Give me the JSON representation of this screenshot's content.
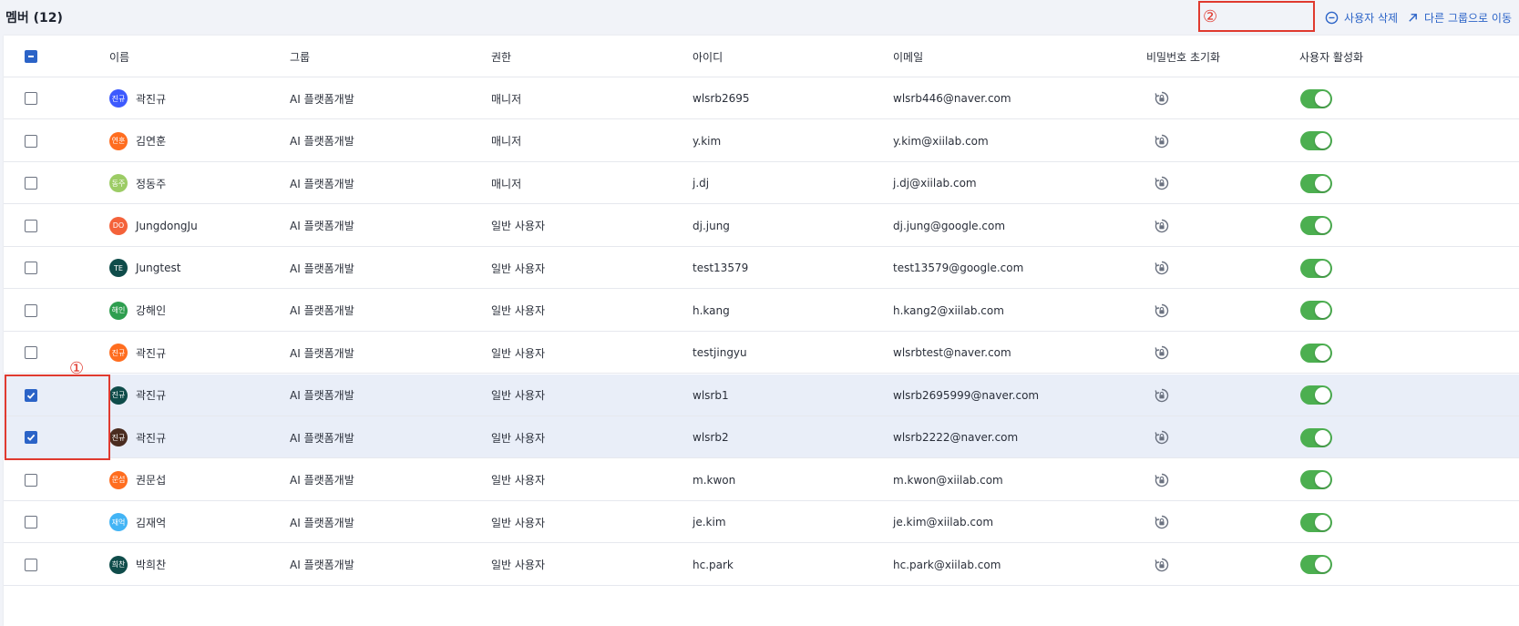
{
  "header": {
    "title": "멤버 (12)",
    "delete_label": "사용자 삭제",
    "move_label": "다른 그룹으로 이동"
  },
  "annotations": {
    "one": "①",
    "two": "②"
  },
  "columns": {
    "name": "이름",
    "group": "그룹",
    "role": "권한",
    "id": "아이디",
    "email": "이메일",
    "reset": "비밀번호 초기화",
    "active": "사용자 활성화"
  },
  "rows": [
    {
      "avatar": "진규",
      "avatar_color": "#3d5afe",
      "name": "곽진규",
      "group": "AI 플랫폼개발",
      "role": "매니저",
      "id": "wlsrb2695",
      "email": "wlsrb446@naver.com",
      "checked": false,
      "active": true
    },
    {
      "avatar": "연훈",
      "avatar_color": "#ff6d1f",
      "name": "김연훈",
      "group": "AI 플랫폼개발",
      "role": "매니저",
      "id": "y.kim",
      "email": "y.kim@xiilab.com",
      "checked": false,
      "active": true
    },
    {
      "avatar": "동주",
      "avatar_color": "#9ccc65",
      "name": "정동주",
      "group": "AI 플랫폼개발",
      "role": "매니저",
      "id": "j.dj",
      "email": "j.dj@xiilab.com",
      "checked": false,
      "active": true
    },
    {
      "avatar": "DO",
      "avatar_color": "#f4623a",
      "name": "JungdongJu",
      "group": "AI 플랫폼개발",
      "role": "일반 사용자",
      "id": "dj.jung",
      "email": "dj.jung@google.com",
      "checked": false,
      "active": true
    },
    {
      "avatar": "TE",
      "avatar_color": "#0f4c4a",
      "name": "Jungtest",
      "group": "AI 플랫폼개발",
      "role": "일반 사용자",
      "id": "test13579",
      "email": "test13579@google.com",
      "checked": false,
      "active": true
    },
    {
      "avatar": "해인",
      "avatar_color": "#2e9e4f",
      "name": "강해인",
      "group": "AI 플랫폼개발",
      "role": "일반 사용자",
      "id": "h.kang",
      "email": "h.kang2@xiilab.com",
      "checked": false,
      "active": true
    },
    {
      "avatar": "진규",
      "avatar_color": "#ff6d1f",
      "name": "곽진규",
      "group": "AI 플랫폼개발",
      "role": "일반 사용자",
      "id": "testjingyu",
      "email": "wlsrbtest@naver.com",
      "checked": false,
      "active": true
    },
    {
      "avatar": "진규",
      "avatar_color": "#0f4c4a",
      "name": "곽진규",
      "group": "AI 플랫폼개발",
      "role": "일반 사용자",
      "id": "wlsrb1",
      "email": "wlsrb2695999@naver.com",
      "checked": true,
      "active": true
    },
    {
      "avatar": "진규",
      "avatar_color": "#4a2c20",
      "name": "곽진규",
      "group": "AI 플랫폼개발",
      "role": "일반 사용자",
      "id": "wlsrb2",
      "email": "wlsrb2222@naver.com",
      "checked": true,
      "active": true
    },
    {
      "avatar": "문섭",
      "avatar_color": "#ff6d1f",
      "name": "권문섭",
      "group": "AI 플랫폼개발",
      "role": "일반 사용자",
      "id": "m.kwon",
      "email": "m.kwon@xiilab.com",
      "checked": false,
      "active": true
    },
    {
      "avatar": "재억",
      "avatar_color": "#42b4f5",
      "name": "김재억",
      "group": "AI 플랫폼개발",
      "role": "일반 사용자",
      "id": "je.kim",
      "email": "je.kim@xiilab.com",
      "checked": false,
      "active": true
    },
    {
      "avatar": "희찬",
      "avatar_color": "#0f4c4a",
      "name": "박희찬",
      "group": "AI 플랫폼개발",
      "role": "일반 사용자",
      "id": "hc.park",
      "email": "hc.park@xiilab.com",
      "checked": false,
      "active": true
    }
  ],
  "colors": {
    "accent": "#2b63c7",
    "toggle_on": "#4caf50",
    "annotation": "#e03a2f",
    "selected_row": "#e9eef8"
  }
}
